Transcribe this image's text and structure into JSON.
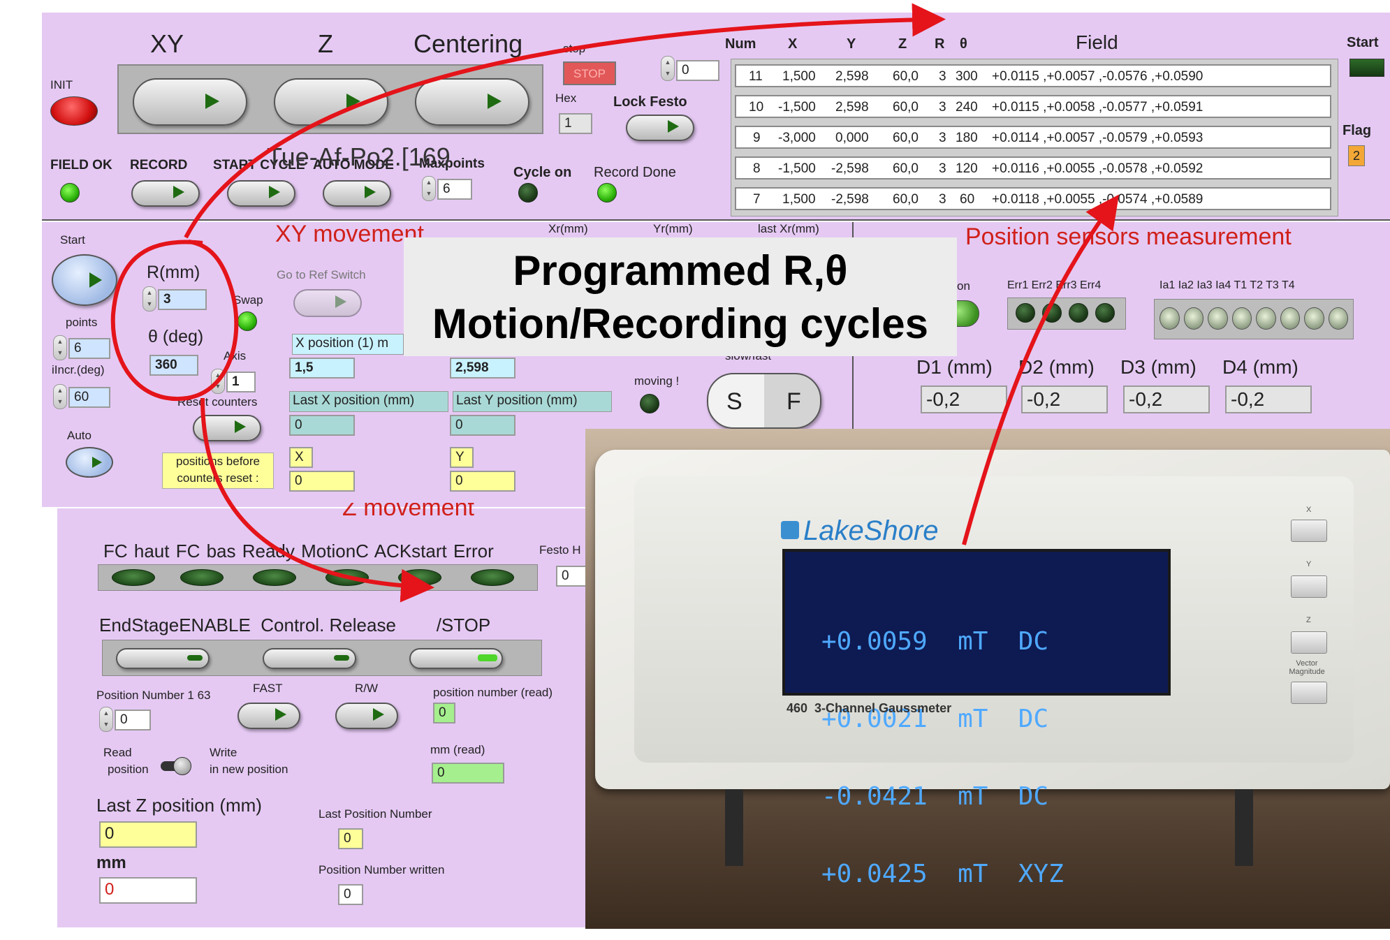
{
  "top": {
    "tabs": [
      "XY",
      "Z",
      "Centering"
    ],
    "init": "INIT",
    "field_ok": "FIELD OK",
    "record": "RECORD",
    "start_cycle": "START CYCLE",
    "auto_mode": "AUTO MODE",
    "maxpoints": "Maxpoints",
    "maxpoints_value": "6",
    "overlay_text": "Tue-Af-Po2.[169",
    "stop_label": "stop",
    "stop_btn": "STOP",
    "stop_counter": "0",
    "hex_label": "Hex",
    "hex_value": "1",
    "lock_festo": "Lock Festo",
    "cycle_on": "Cycle on",
    "record_done": "Record Done",
    "start_label": "Start",
    "flag_label": "Flag",
    "flag_value": "2"
  },
  "table": {
    "headers": [
      "Num",
      "X",
      "Y",
      "Z",
      "R",
      "θ",
      "Field"
    ],
    "rows": [
      [
        "11",
        "1,500",
        "2,598",
        "60,0",
        "3",
        "300",
        "+0.0115 ,+0.0057 ,-0.0576 ,+0.0590"
      ],
      [
        "10",
        "-1,500",
        "2,598",
        "60,0",
        "3",
        "240",
        "+0.0115 ,+0.0058 ,-0.0577 ,+0.0591"
      ],
      [
        "9",
        "-3,000",
        "0,000",
        "60,0",
        "3",
        "180",
        "+0.0114 ,+0.0057 ,-0.0579 ,+0.0593"
      ],
      [
        "8",
        "-1,500",
        "-2,598",
        "60,0",
        "3",
        "120",
        "+0.0116 ,+0.0055 ,-0.0578 ,+0.0592"
      ],
      [
        "7",
        "1,500",
        "-2,598",
        "60,0",
        "3",
        "60",
        "+0.0118 ,+0.0055 ,-0.0574 ,+0.0589"
      ]
    ]
  },
  "xy": {
    "title": "XY movement",
    "start": "Start",
    "r_label": "R(mm)",
    "r_value": "3",
    "theta_label": "θ (deg)",
    "theta_value": "360",
    "points_label": "points",
    "points_value": "6",
    "incr_label": "iIncr.(deg)",
    "incr_value": "60",
    "auto": "Auto",
    "swap": "Swap",
    "go_ref": "Go to Ref Switch",
    "axis_label": "Axis",
    "axis_value": "1",
    "reset_counters": "Reset counters",
    "pos_before_1": "positions before",
    "pos_before_2": "counters reset :",
    "xr": "Xr(mm)",
    "yr": "Yr(mm)",
    "last_xr": "last Xr(mm)",
    "x_pos_label": "X position (1) m",
    "x_pos_value": "1,5",
    "y_pos_value": "2,598",
    "last_x_label": "Last X position (mm)",
    "last_y_label": "Last Y position (mm)",
    "last_x_value": "0",
    "last_y_value": "0",
    "x_tag": "X",
    "y_tag": "Y",
    "x_before": "0",
    "y_before": "0",
    "moving": "moving !",
    "slow_fast": "slow/fast",
    "s": "S",
    "f": "F"
  },
  "sensors": {
    "title": "Position sensors measurement",
    "on_label": "on",
    "errs": "Err1 Err2 Err3 Err4",
    "ia": "Ia1  Ia2  Ia3  Ia4   T1   T2   T3   T4",
    "d_labels": [
      "D1 (mm)",
      "D2 (mm)",
      "D3 (mm)",
      "D4 (mm)"
    ],
    "d_values": [
      "-0,2",
      "-0,2",
      "-0,2",
      "-0,2"
    ]
  },
  "z": {
    "title": "Z movement",
    "indicators": "FC haut  FC bas  Ready  MotionC  ACKstart  Error",
    "festo_h": "Festo H",
    "festo_value": "0",
    "endstage": "EndStageENABLE  Control. Release        /STOP",
    "pos_num_label": "Position Number 1 63",
    "pos_num_value": "0",
    "fast": "FAST",
    "rw": "R/W",
    "pos_num_read_label": "position number (read)",
    "pos_num_read_value": "0",
    "read_pos_1": "Read",
    "read_pos_2": "position",
    "write_1": "Write",
    "write_2": "in new position",
    "mm_read_label": "mm (read)",
    "mm_read_value": "0",
    "last_z_label": "Last Z position (mm)",
    "last_z_value": "0",
    "mm_label": "mm",
    "mm_value": "0",
    "last_pos_num_label": "Last Position Number",
    "last_pos_num_value": "0",
    "pos_written_label": "Position Number written",
    "pos_written_value": "0"
  },
  "callout": {
    "line1": "Programmed R,θ",
    "line2": "Motion/Recording cycles"
  },
  "gaussmeter": {
    "brand": "LakeShore",
    "model": "460  3-Channel Gaussmeter",
    "readings": [
      "+0.0059  mT  DC",
      "+0.0021  mT  DC",
      "-0.0421  mT  DC",
      "+0.0425  mT  XYZ"
    ],
    "buttons": [
      "X",
      "Y",
      "Z",
      "Vector Magnitude"
    ]
  }
}
